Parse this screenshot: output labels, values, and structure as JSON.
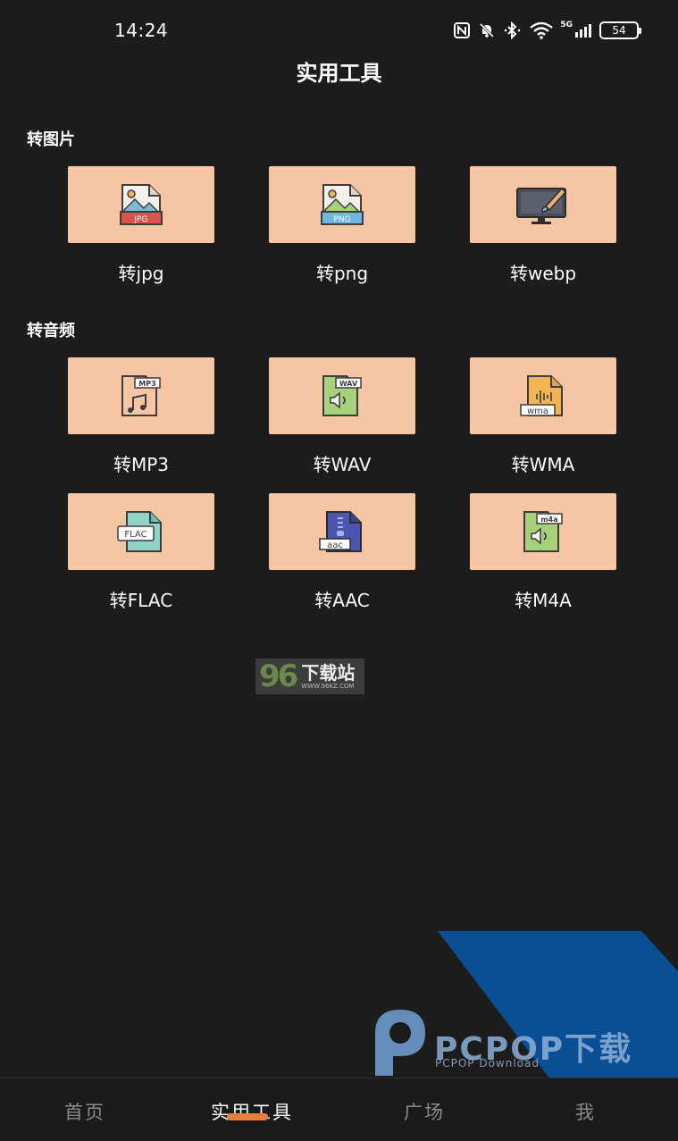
{
  "status": {
    "time": "14:24",
    "signal_label": "5G",
    "battery": "54"
  },
  "title": "实用工具",
  "sections": [
    {
      "title": "转图片",
      "tools": [
        {
          "label": "转jpg",
          "icon": "jpg-image-icon",
          "badge": "JPG"
        },
        {
          "label": "转png",
          "icon": "png-image-icon",
          "badge": "PNG"
        },
        {
          "label": "转webp",
          "icon": "monitor-brush-icon",
          "badge": ""
        }
      ]
    },
    {
      "title": "转音频",
      "tools": [
        {
          "label": "转MP3",
          "icon": "mp3-file-icon",
          "badge": "MP3"
        },
        {
          "label": "转WAV",
          "icon": "wav-file-icon",
          "badge": "WAV"
        },
        {
          "label": "转WMA",
          "icon": "wma-file-icon",
          "badge": "wma"
        },
        {
          "label": "转FLAC",
          "icon": "flac-file-icon",
          "badge": "FLAC"
        },
        {
          "label": "转AAC",
          "icon": "aac-file-icon",
          "badge": "aac"
        },
        {
          "label": "转M4A",
          "icon": "m4a-file-icon",
          "badge": "m4a"
        }
      ]
    }
  ],
  "watermarks": {
    "site96_num": "96",
    "site96_name": "下载站",
    "site96_url": "WWW.96KZ.COM",
    "pcpop_name": "PCPOP下载",
    "pcpop_sub": "PCPOP Download"
  },
  "nav": {
    "items": [
      {
        "label": "首页"
      },
      {
        "label": "实用工具"
      },
      {
        "label": "广场"
      },
      {
        "label": "我"
      }
    ]
  },
  "colors": {
    "background": "#1c1c1c",
    "card": "#f6c5a3",
    "accent": "#f07b3f",
    "inactive_nav": "#8a8a8a",
    "pcpop_blue": "#0a4f94"
  }
}
